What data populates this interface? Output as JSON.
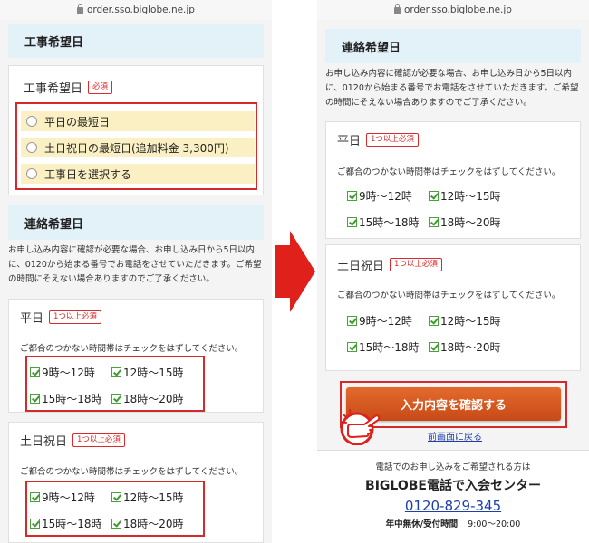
{
  "url": "order.sso.biglobe.ne.jp",
  "left": {
    "construction_section_title": "工事希望日",
    "construction_box_title": "工事希望日",
    "required_badge": "必須",
    "radio_options": [
      "平日の最短日",
      "土日祝日の最短日(追加料金 3,300円)",
      "工事日を選択する"
    ],
    "contact_section_title": "連絡希望日",
    "contact_note": "お申し込み内容に確認が必要な場合、お申し込み日から5日以内に、0120から始まる番号でお電話をさせていただきます。ご希望の時間にそえない場合ありますのでご了承ください。",
    "weekday": {
      "title": "平日",
      "badge": "1つ以上必須",
      "note": "ご都合のつかない時間帯はチェックをはずしてください。",
      "slots": [
        "9時〜12時",
        "12時〜15時",
        "15時〜18時",
        "18時〜20時"
      ]
    },
    "holiday": {
      "title": "土日祝日",
      "badge": "1つ以上必須",
      "note": "ご都合のつかない時間帯はチェックをはずしてください。",
      "slots": [
        "9時〜12時",
        "12時〜15時",
        "15時〜18時",
        "18時〜20時"
      ]
    }
  },
  "right": {
    "contact_section_title": "連絡希望日",
    "contact_note": "お申し込み内容に確認が必要な場合、お申し込み日から5日以内に、0120から始まる番号でお電話をさせていただきます。ご希望の時間にそえない場合ありますのでご了承ください。",
    "weekday": {
      "title": "平日",
      "badge": "1つ以上必須",
      "note": "ご都合のつかない時間帯はチェックをはずしてください。",
      "slots": [
        "9時〜12時",
        "12時〜15時",
        "15時〜18時",
        "18時〜20時"
      ]
    },
    "holiday": {
      "title": "土日祝日",
      "badge": "1つ以上必須",
      "note": "ご都合のつかない時間帯はチェックをはずしてください。",
      "slots": [
        "9時〜12時",
        "12時〜15時",
        "15時〜18時",
        "18時〜20時"
      ]
    },
    "confirm_button": "入力内容を確認する",
    "back_link": "前画面に戻る",
    "phone_intro": "電話でのお申し込みをご希望される方は",
    "center_name": "BIGLOBE電話で入会センター",
    "phone_number": "0120-829-345",
    "hours_label": "年中無休/受付時間",
    "hours_value": "9:00〜20:00"
  },
  "colors": {
    "highlight_red": "#d42a2a",
    "arrow_red": "#e0211b",
    "section_blue": "#e3f1f8",
    "radio_yellow": "#fbf0c3",
    "button_orange": "#d85a22",
    "link_blue": "#1d3fa8"
  }
}
